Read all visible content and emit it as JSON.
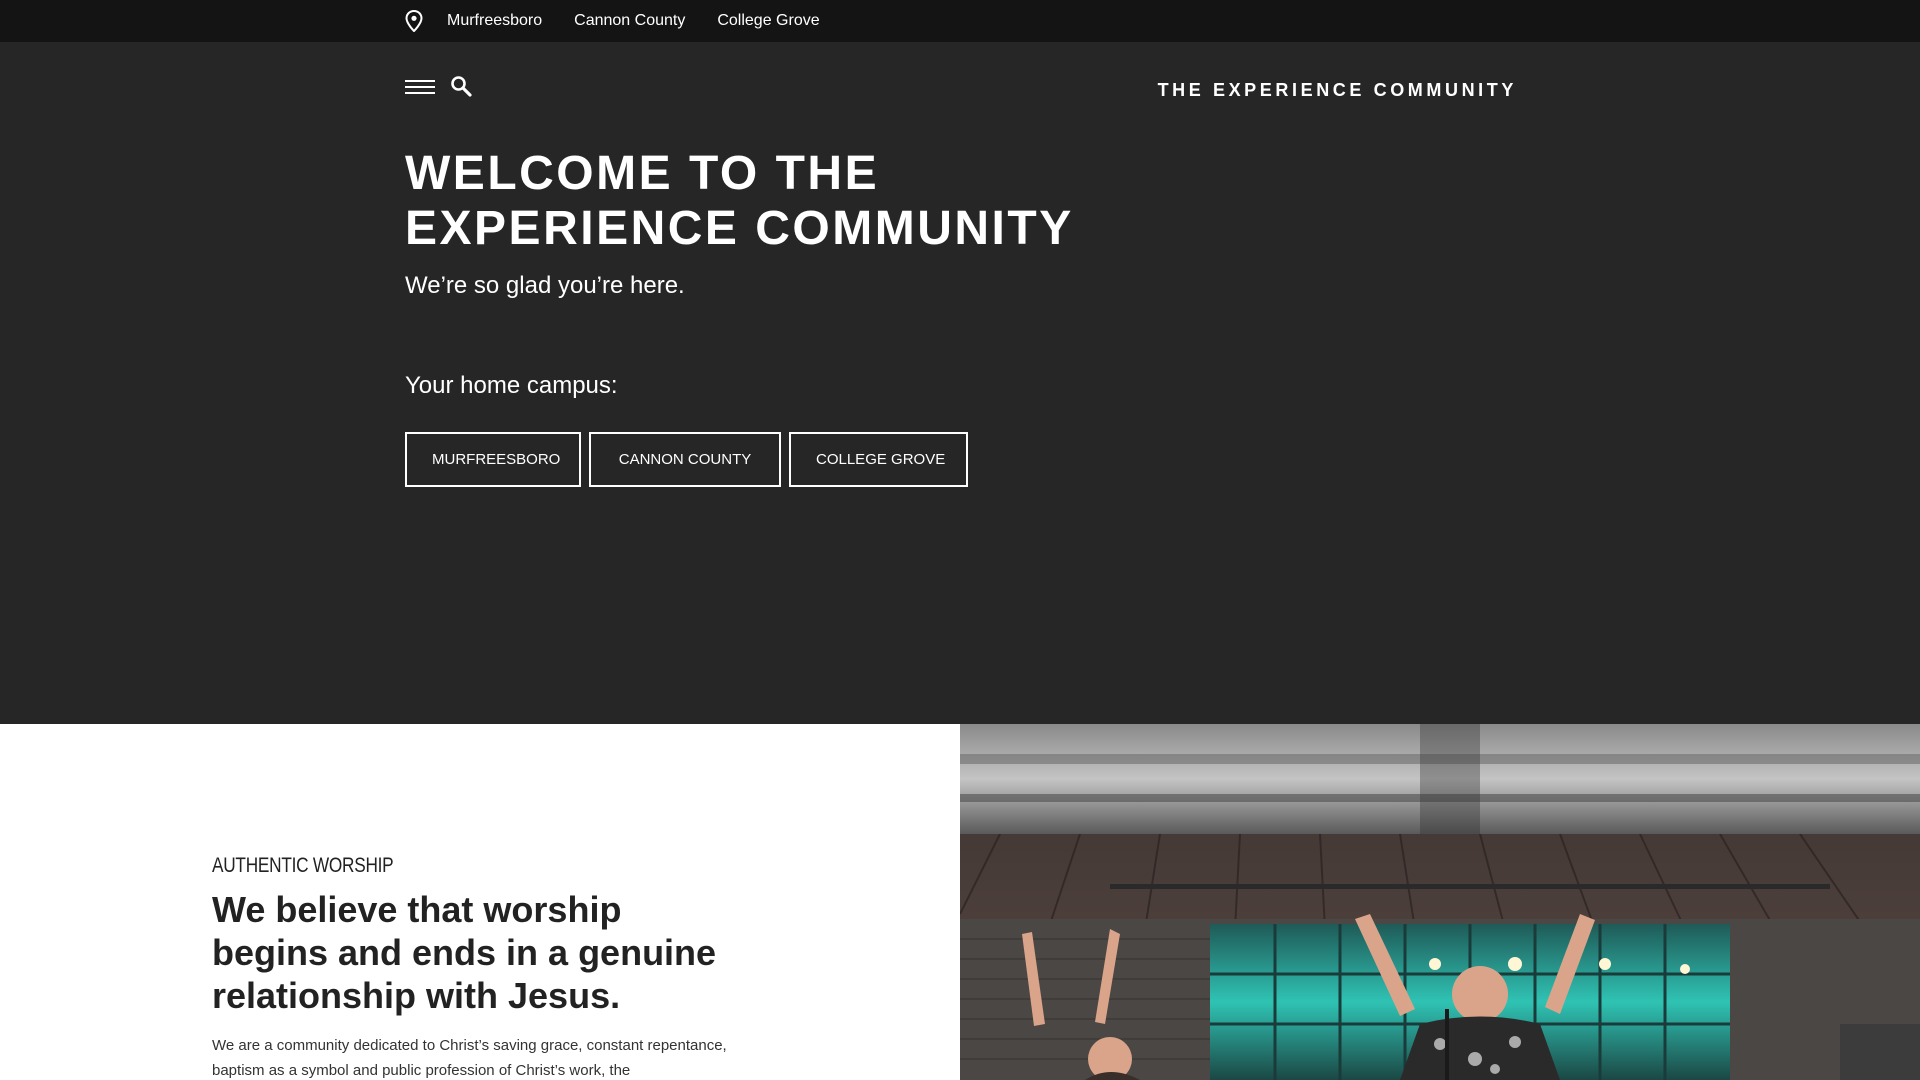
{
  "topbar": {
    "icon": "map-pin-icon",
    "campuses": [
      "Murfreesboro",
      "Cannon County",
      "College Grove"
    ]
  },
  "header": {
    "menu_icon": "hamburger-menu-icon",
    "search_icon": "search-icon",
    "brand": "THE EXPERIENCE COMMUNITY"
  },
  "hero": {
    "title": "WELCOME TO THE EXPERIENCE COMMUNITY",
    "subtitle": "We’re so glad you’re here.",
    "campus_label": "Your home campus:",
    "campus_buttons": [
      "MURFREESBORO",
      "CANNON COUNTY",
      "COLLEGE GROVE"
    ]
  },
  "worship": {
    "eyebrow": "AUTHENTIC WORSHIP",
    "heading": "We believe that worship begins and ends in a genuine relationship with Jesus.",
    "body": "We are a community dedicated to Christ’s saving grace, constant repentance, baptism as a symbol and public profession of Christ’s work, the"
  },
  "colors": {
    "topbar_bg": "#141414",
    "hero_bg": "#262626",
    "section_bg": "#ffffff",
    "accent_teal": "#2fc3b4"
  }
}
